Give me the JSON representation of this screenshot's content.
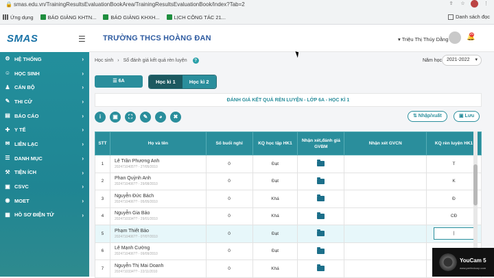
{
  "browser": {
    "url": "smas.edu.vn/TrainingResultsEvaluationBookArea/TrainingResultsEvaluationBook/Index?Tab=2",
    "bookmarks": [
      {
        "label": "Ứng dụng",
        "type": "apps"
      },
      {
        "label": "BÁO GIẢNG KHTN...",
        "type": "page"
      },
      {
        "label": "BÁO GIẢNG KHXH...",
        "type": "page"
      },
      {
        "label": "LỊCH CÔNG TÁC 21...",
        "type": "page"
      }
    ],
    "reading_list": "Danh sách đọc"
  },
  "header": {
    "logo_main": "SMAS",
    "school_name": "TRƯỜNG THCS HOÀNG ĐAN",
    "user_name": "▾ Triệu Thị Thúy Dằng",
    "notification_count": "20"
  },
  "sidebar": {
    "items": [
      {
        "label": "HỆ THỐNG",
        "icon": "⚙"
      },
      {
        "label": "HỌC SINH",
        "icon": "☺"
      },
      {
        "label": "CÁN BỘ",
        "icon": "♟"
      },
      {
        "label": "THI CỬ",
        "icon": "✎"
      },
      {
        "label": "BÁO CÁO",
        "icon": "▤"
      },
      {
        "label": "Y TẾ",
        "icon": "✚"
      },
      {
        "label": "LIÊN LẠC",
        "icon": "✉"
      },
      {
        "label": "DANH MỤC",
        "icon": "☰"
      },
      {
        "label": "TIỆN ÍCH",
        "icon": "⚒"
      },
      {
        "label": "CSVC",
        "icon": "▣"
      },
      {
        "label": "MOET",
        "icon": "◉"
      },
      {
        "label": "HỒ SƠ ĐIỆN TỬ",
        "icon": "▦"
      }
    ]
  },
  "breadcrumb": {
    "item1": "Học sinh",
    "sep": "›",
    "item2": "Sổ đánh giá kết quả rèn luyện",
    "help": "?"
  },
  "year": {
    "label": "Năm học",
    "value": "2021-2022"
  },
  "class_button": "☰ 6A",
  "terms": {
    "term1": "Học kì 1",
    "term2": "Học kì 2"
  },
  "page_title": "ĐÁNH GIÁ KẾT QUẢ RÈN LUYỆN - LỚP 6A - HỌC KÌ 1",
  "toolbar": {
    "info": "i",
    "save_icon": "▣",
    "expand": "⛶",
    "edit": "✎",
    "chart": "◕",
    "delete": "✖",
    "export_label": "⇅ Nhập/xuất",
    "save_label": "▣ Lưu"
  },
  "table": {
    "headers": {
      "stt": "STT",
      "name": "Họ và tên",
      "absent": "Số buổi nghỉ",
      "study": "KQ học tập HK1",
      "gvbm": "Nhận xét,đánh giá GVBM",
      "gvcn": "Nhận xét GVCN",
      "conduct": "KQ rèn luyện HK1"
    },
    "rows": [
      {
        "stt": "1",
        "name": "Lê Trần Phương Anh",
        "dob": "2024710405?? - 2?/05/2010",
        "absent": "0",
        "study": "Đạt",
        "conduct": "T"
      },
      {
        "stt": "2",
        "name": "Phan Quỳnh Anh",
        "dob": "2024710406?? - 29/08/2010",
        "absent": "0",
        "study": "Đạt",
        "conduct": "K"
      },
      {
        "stt": "3",
        "name": "Nguyễn Đức Bách",
        "dob": "2024710406?? - 05/05/2010",
        "absent": "0",
        "study": "Khá",
        "conduct": "Đ"
      },
      {
        "stt": "4",
        "name": "Nguyễn Gia Bảo",
        "dob": "2024710334?? - 29/01/2010",
        "absent": "0",
        "study": "Khá",
        "conduct": "CĐ"
      },
      {
        "stt": "5",
        "name": "Phạm Thiết Bảo",
        "dob": "2024710406?? - 0?/0?/2010",
        "absent": "0",
        "study": "Đạt",
        "conduct": "|"
      },
      {
        "stt": "6",
        "name": "Lê Mạnh Cường",
        "dob": "2024710406?? - 09/09/2010",
        "absent": "0",
        "study": "Đạt",
        "conduct": ""
      },
      {
        "stt": "7",
        "name": "Nguyễn Thị Mai Doanh",
        "dob": "2024710334?? - 22/11/2010",
        "absent": "0",
        "study": "Khá",
        "conduct": ""
      }
    ]
  },
  "overlay": {
    "brand": "YouCam 5",
    "sub": "www.perfectcorp.com"
  }
}
